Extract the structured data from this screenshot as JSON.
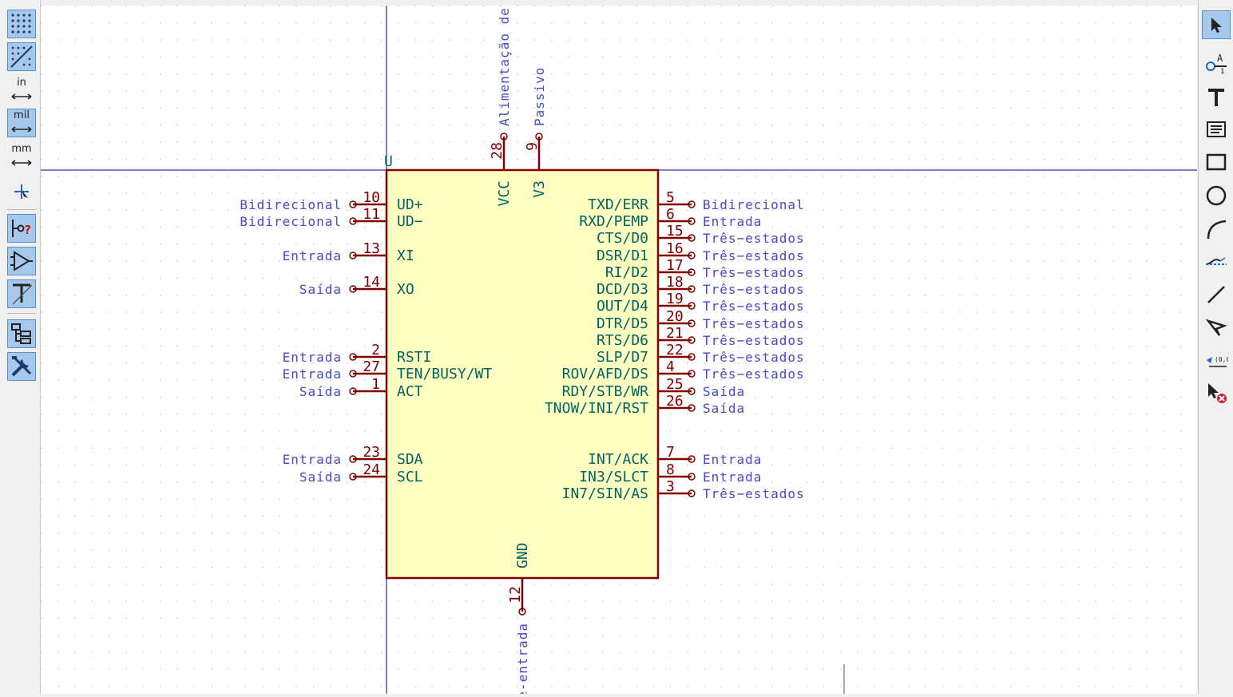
{
  "left_toolbar": {
    "unit_in": "in",
    "unit_mil": "mil",
    "unit_mm": "mm"
  },
  "component": {
    "reference": "U",
    "left_pins": [
      {
        "num": "10",
        "name": "UD+",
        "type": "Bidirecional"
      },
      {
        "num": "11",
        "name": "UD−",
        "type": "Bidirecional"
      },
      {
        "num": "13",
        "name": "XI",
        "type": "Entrada"
      },
      {
        "num": "14",
        "name": "XO",
        "type": "Saída"
      },
      {
        "num": "2",
        "name": "RSTI",
        "type": "Entrada"
      },
      {
        "num": "27",
        "name": "TEN/BUSY/WT",
        "type": "Entrada"
      },
      {
        "num": "1",
        "name": "ACT",
        "type": "Saída"
      },
      {
        "num": "23",
        "name": "SDA",
        "type": "Entrada"
      },
      {
        "num": "24",
        "name": "SCL",
        "type": "Saída"
      }
    ],
    "right_pins": [
      {
        "num": "5",
        "name": "TXD/ERR",
        "type": "Bidirecional"
      },
      {
        "num": "6",
        "name": "RXD/PEMP",
        "type": "Entrada"
      },
      {
        "num": "15",
        "name": "CTS/D0",
        "type": "Três−estados"
      },
      {
        "num": "16",
        "name": "DSR/D1",
        "type": "Três−estados"
      },
      {
        "num": "17",
        "name": "RI/D2",
        "type": "Três−estados"
      },
      {
        "num": "18",
        "name": "DCD/D3",
        "type": "Três−estados"
      },
      {
        "num": "19",
        "name": "OUT/D4",
        "type": "Três−estados"
      },
      {
        "num": "20",
        "name": "DTR/D5",
        "type": "Três−estados"
      },
      {
        "num": "21",
        "name": "RTS/D6",
        "type": "Três−estados"
      },
      {
        "num": "22",
        "name": "SLP/D7",
        "type": "Três−estados"
      },
      {
        "num": "4",
        "name": "ROV/AFD/DS",
        "type": "Três−estados"
      },
      {
        "num": "25",
        "name": "RDY/STB/WR",
        "type": "Saída"
      },
      {
        "num": "26",
        "name": "TNOW/INI/RST",
        "type": "Saída"
      },
      {
        "num": "7",
        "name": "INT/ACK",
        "type": "Entrada"
      },
      {
        "num": "8",
        "name": "IN3/SLCT",
        "type": "Entrada"
      },
      {
        "num": "3",
        "name": "IN7/SIN/AS",
        "type": "Três−estados"
      }
    ],
    "top_pins": [
      {
        "num": "28",
        "name": "VCC",
        "type": "Alimentação de e"
      },
      {
        "num": "9",
        "name": "V3",
        "type": "Passivo"
      }
    ],
    "bottom_pins": [
      {
        "num": "12",
        "name": "GND",
        "type": "le-entrada"
      }
    ]
  },
  "colors": {
    "body_fill": "#ffffc2",
    "body_stroke": "#840000",
    "pin_name": "#006464",
    "pin_type": "#4848c8",
    "axis": "#00008c"
  }
}
